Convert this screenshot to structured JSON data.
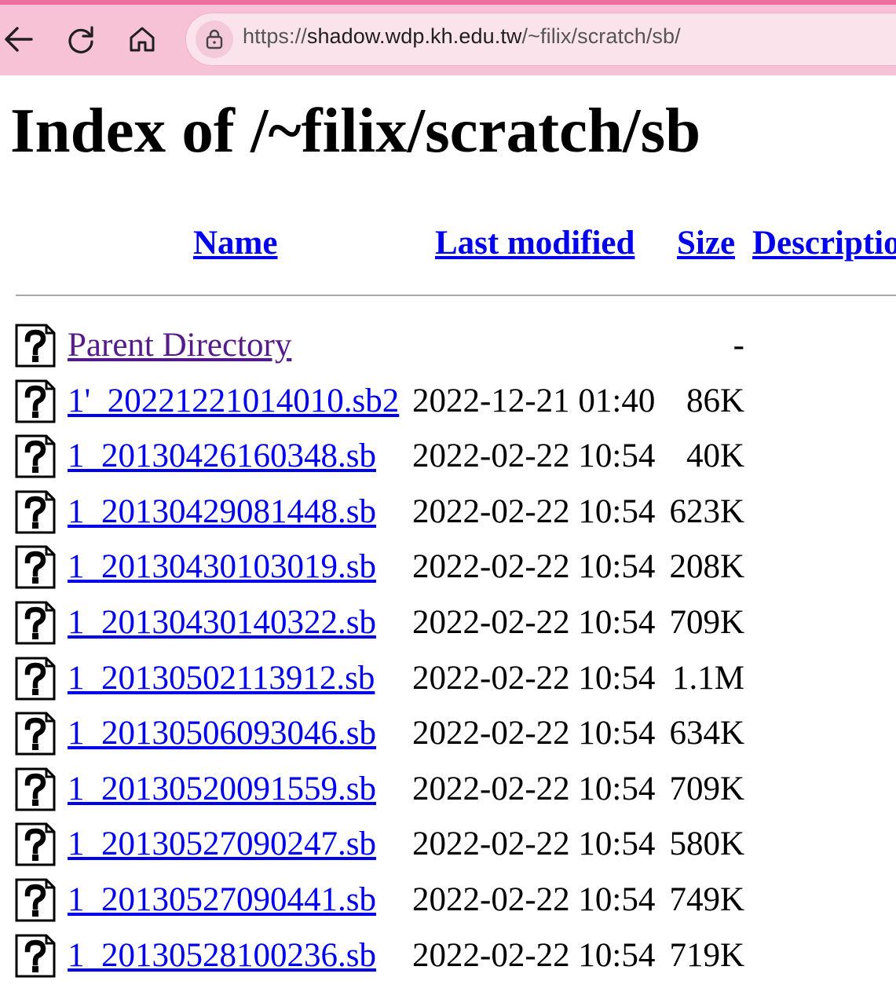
{
  "browser": {
    "url_prefix": "https://",
    "url_host": "shadow.wdp.kh.edu.tw",
    "url_path": "/~filix/scratch/sb/",
    "icons": {
      "back": "arrow-left-icon",
      "reload": "reload-icon",
      "home": "home-icon",
      "security": "lock-icon"
    },
    "colors": {
      "chrome": "#f7c2d5",
      "accent": "#ec6f9d",
      "url_bar": "#fbe3ec"
    }
  },
  "page": {
    "title": "Index of /~filix/scratch/sb"
  },
  "table": {
    "headers": {
      "name": "Name",
      "modified": "Last modified",
      "size": "Size",
      "description": "Description"
    },
    "parent": {
      "label": "Parent Directory",
      "size": "-"
    },
    "files": [
      {
        "name": "1'_20221221014010.sb2",
        "modified": "2022-12-21 01:40",
        "size": "86K"
      },
      {
        "name": "1_20130426160348.sb",
        "modified": "2022-02-22 10:54",
        "size": "40K"
      },
      {
        "name": "1_20130429081448.sb",
        "modified": "2022-02-22 10:54",
        "size": "623K"
      },
      {
        "name": "1_20130430103019.sb",
        "modified": "2022-02-22 10:54",
        "size": "208K"
      },
      {
        "name": "1_20130430140322.sb",
        "modified": "2022-02-22 10:54",
        "size": "709K"
      },
      {
        "name": "1_20130502113912.sb",
        "modified": "2022-02-22 10:54",
        "size": "1.1M"
      },
      {
        "name": "1_20130506093046.sb",
        "modified": "2022-02-22 10:54",
        "size": "634K"
      },
      {
        "name": "1_20130520091559.sb",
        "modified": "2022-02-22 10:54",
        "size": "709K"
      },
      {
        "name": "1_20130527090247.sb",
        "modified": "2022-02-22 10:54",
        "size": "580K"
      },
      {
        "name": "1_20130527090441.sb",
        "modified": "2022-02-22 10:54",
        "size": "749K"
      },
      {
        "name": "1_20130528100236.sb",
        "modified": "2022-02-22 10:54",
        "size": "719K"
      }
    ],
    "file_icon": "unknown-file-icon",
    "colors": {
      "link": "#0000ee",
      "visited_link": "#551a8b"
    }
  }
}
